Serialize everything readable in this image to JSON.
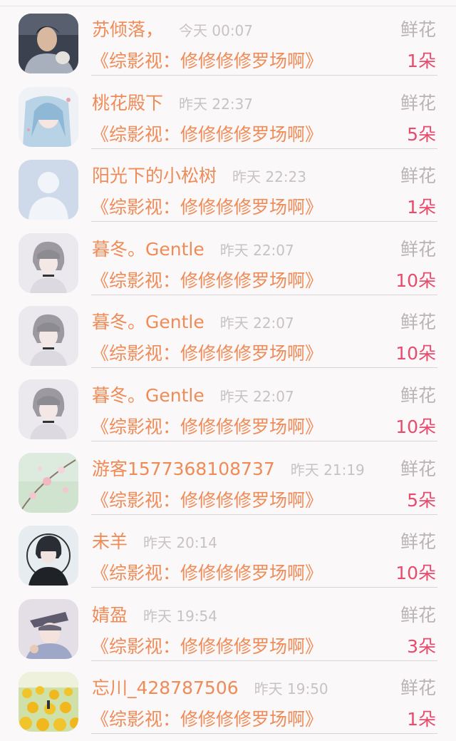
{
  "items": [
    {
      "name": "苏倾落，",
      "time": "今天 00:07",
      "type": "鲜花",
      "book": "《综影视：修修修修罗场啊》",
      "count": "1朵",
      "avatar": "avatar-photo-icon"
    },
    {
      "name": "桃花殿下",
      "time": "昨天 22:37",
      "type": "鲜花",
      "book": "《综影视：修修修修罗场啊》",
      "count": "5朵",
      "avatar": "avatar-anime-blue-icon"
    },
    {
      "name": "阳光下的小松树",
      "time": "昨天 22:23",
      "type": "鲜花",
      "book": "《综影视：修修修修罗场啊》",
      "count": "1朵",
      "avatar": "default-user-icon"
    },
    {
      "name": "暮冬。Gentle",
      "time": "昨天 22:07",
      "type": "鲜花",
      "book": "《综影视：修修修修罗场啊》",
      "count": "10朵",
      "avatar": "avatar-anime-gray-icon"
    },
    {
      "name": "暮冬。Gentle",
      "time": "昨天 22:07",
      "type": "鲜花",
      "book": "《综影视：修修修修罗场啊》",
      "count": "10朵",
      "avatar": "avatar-anime-gray-icon"
    },
    {
      "name": "暮冬。Gentle",
      "time": "昨天 22:07",
      "type": "鲜花",
      "book": "《综影视：修修修修罗场啊》",
      "count": "10朵",
      "avatar": "avatar-anime-gray-icon"
    },
    {
      "name": "游客1577368108737",
      "time": "昨天 21:19",
      "type": "鲜花",
      "book": "《综影视：修修修修罗场啊》",
      "count": "5朵",
      "avatar": "avatar-blossom-icon"
    },
    {
      "name": "未羊",
      "time": "昨天 20:14",
      "type": "鲜花",
      "book": "《综影视：修修修修罗场啊》",
      "count": "10朵",
      "avatar": "avatar-dark-anime-icon"
    },
    {
      "name": "婧盈",
      "time": "昨天 19:54",
      "type": "鲜花",
      "book": "《综影视：修修修修罗场啊》",
      "count": "3朵",
      "avatar": "avatar-anime-hat-icon"
    },
    {
      "name": "忘川_428787506",
      "time": "昨天 19:50",
      "type": "鲜花",
      "book": "《综影视：修修修修罗场啊》",
      "count": "1朵",
      "avatar": "avatar-sunflower-icon"
    }
  ]
}
